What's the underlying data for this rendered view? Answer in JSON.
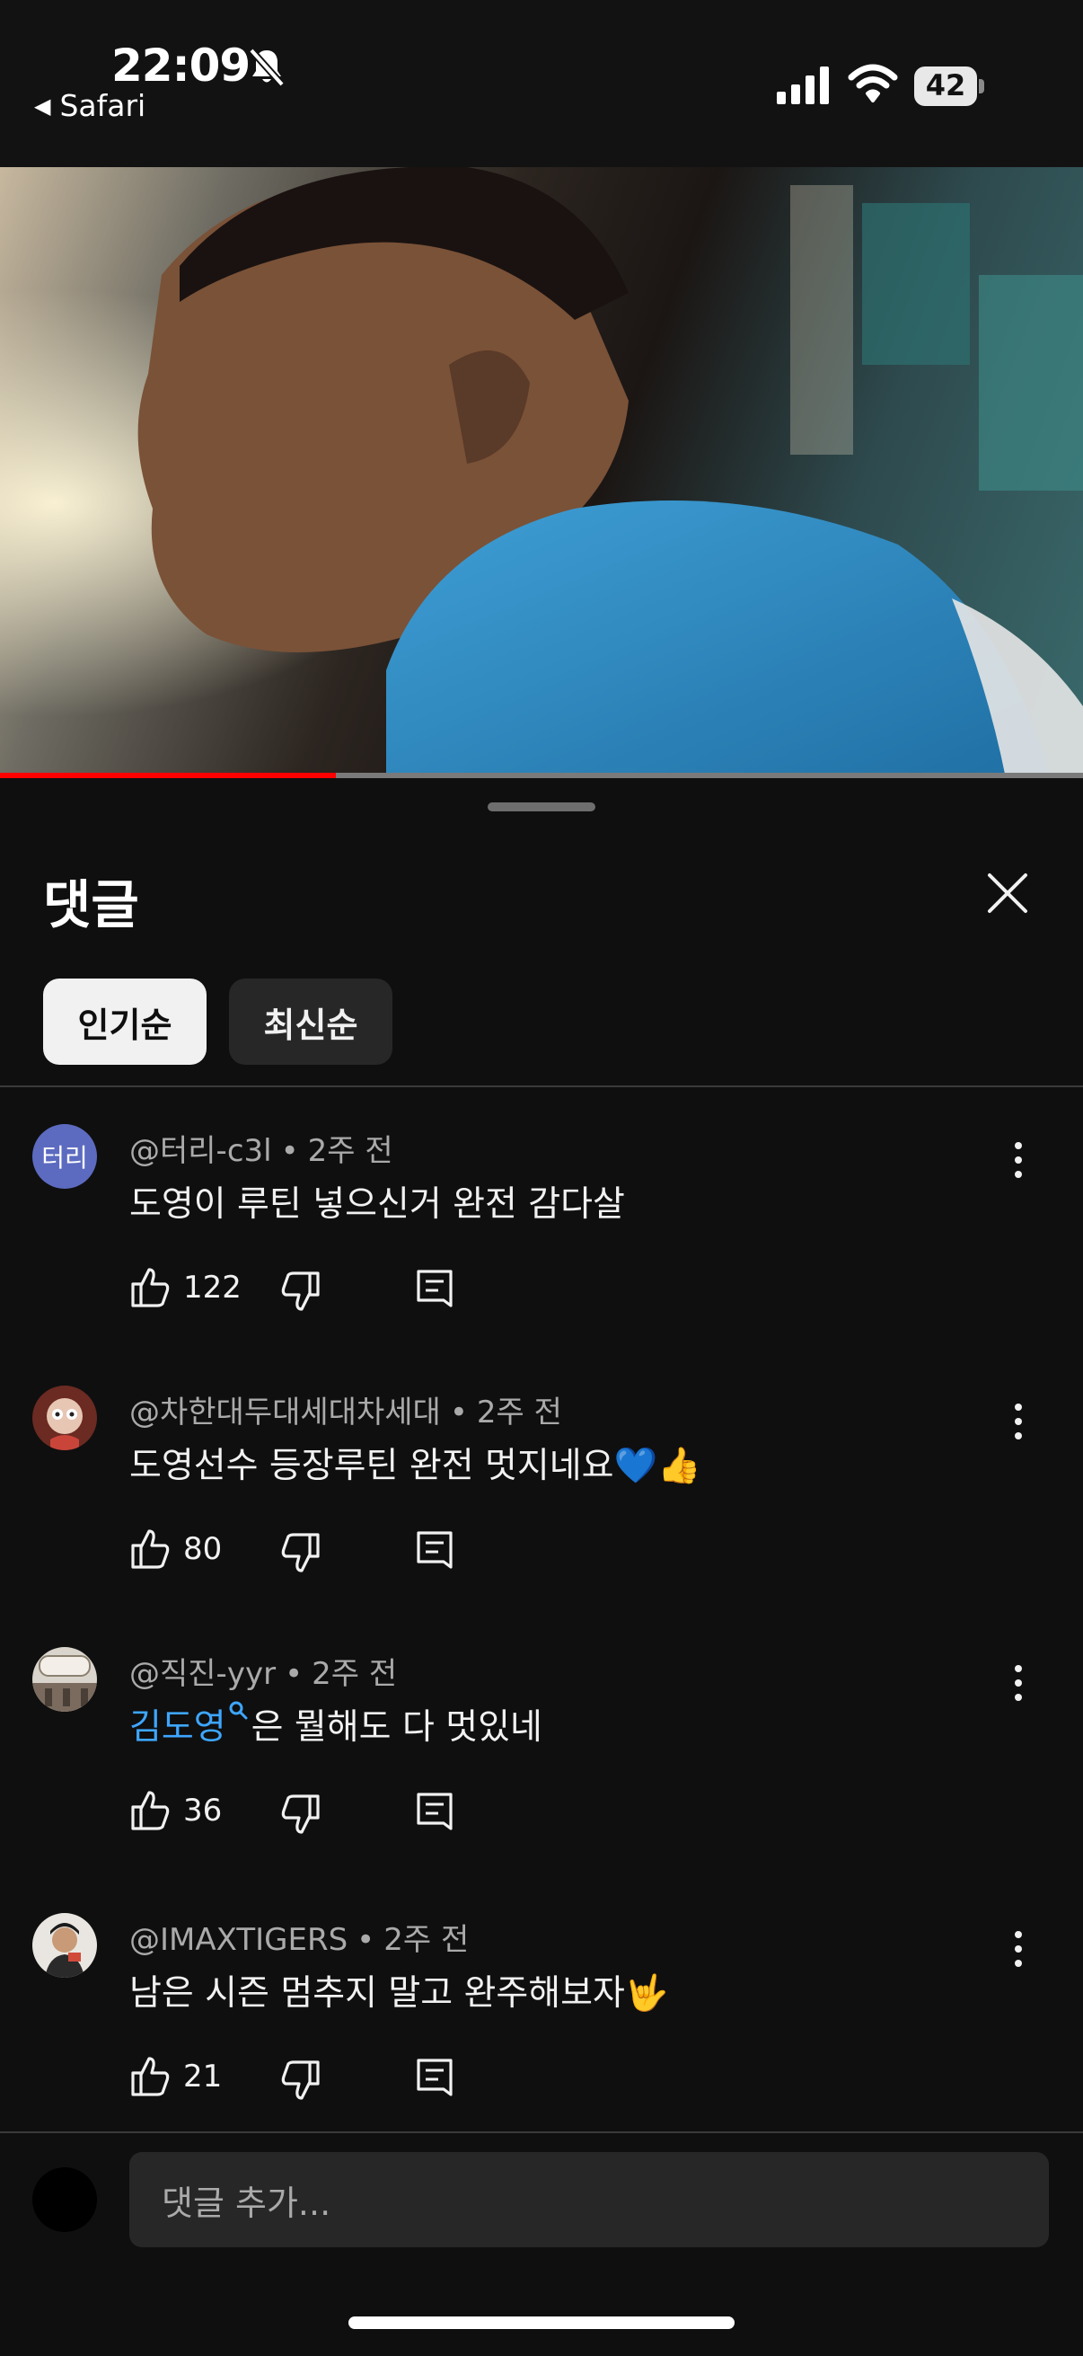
{
  "status_bar": {
    "time": "22:09",
    "back_app": "Safari",
    "battery": "42",
    "icons": [
      "bell-slash-icon",
      "signal-icon",
      "wifi-icon",
      "battery-icon"
    ]
  },
  "video": {
    "progress_fraction": 0.31,
    "accent_color": "#ff0000"
  },
  "comments_panel": {
    "title": "댓글",
    "sort_tabs": [
      {
        "label": "인기순",
        "selected": true
      },
      {
        "label": "최신순",
        "selected": false
      }
    ],
    "comments": [
      {
        "author": "@터리-c3l",
        "time": "2주 전",
        "text": "도영이 루틴 넣으신거 완전 감다살",
        "likes": "122",
        "avatar_text": "터리",
        "avatar_color": "#5c6bc0"
      },
      {
        "author": "@차한대두대세대차세대",
        "time": "2주 전",
        "text": "도영선수 등장루틴 완전 멋지네요💙👍",
        "likes": "80"
      },
      {
        "author": "@직진-yyr",
        "time": "2주 전",
        "mention": "김도영",
        "text": "은 뭘해도 다 멋있네",
        "likes": "36"
      },
      {
        "author": "@IMAXTIGERS",
        "time": "2주 전",
        "text": "남은 시즌 멈추지 말고 완주해보자🤟",
        "likes": "21"
      }
    ],
    "composer_placeholder": "댓글 추가..."
  },
  "colors": {
    "background": "#0f0f0f",
    "chip_selected": "#f1f1f1",
    "chip_unselected": "#272727",
    "secondary_text": "#aaaaaa",
    "mention_link": "#3ea6ff"
  }
}
